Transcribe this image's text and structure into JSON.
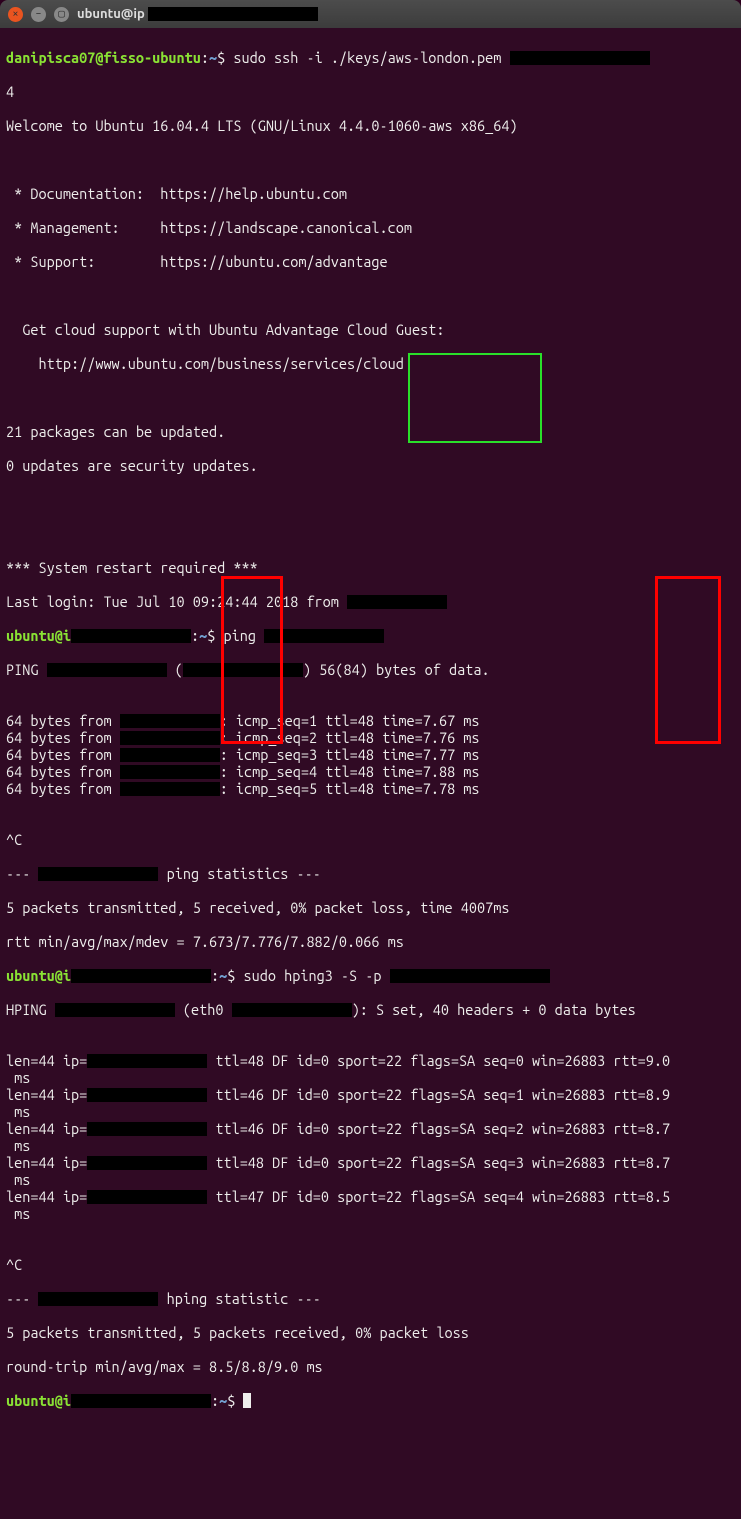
{
  "window": {
    "title_prefix": "ubuntu@ip"
  },
  "prompt1": {
    "user": "danipisca07",
    "host": "fisso-ubuntu",
    "path": "~",
    "cmd": "sudo ssh -i ./keys/aws-london.pem "
  },
  "motd": {
    "l1": "4",
    "l2": "Welcome to Ubuntu 16.04.4 LTS (GNU/Linux 4.4.0-1060-aws x86_64)",
    "doc": " * Documentation:  https://help.ubuntu.com",
    "mgmt": " * Management:     https://landscape.canonical.com",
    "sup": " * Support:        https://ubuntu.com/advantage",
    "cloud1": "  Get cloud support with Ubuntu Advantage Cloud Guest:",
    "cloud2": "    http://www.ubuntu.com/business/services/cloud",
    "pkg1": "21 packages can be updated.",
    "pkg2": "0 updates are security updates.",
    "restart": "*** System restart required ***",
    "last": "Last login: Tue Jul 10 09:24:44 2018 from "
  },
  "prompt2": {
    "user": "ubuntu",
    "host_prefix": "i",
    "path": "~",
    "cmd": "ping "
  },
  "ping_header_a": "PING ",
  "ping_header_b": " (",
  "ping_header_c": ") 56(84) bytes of data.",
  "ping_rows": [
    {
      "prefix": "64 bytes from ",
      "tail": ": icmp_seq=1",
      "ttl": "ttl=48",
      "time": "time=7.67 ms"
    },
    {
      "prefix": "64 bytes from ",
      "tail": ": icmp_seq=2",
      "ttl": "ttl=48",
      "time": "time=7.76 ms"
    },
    {
      "prefix": "64 bytes from ",
      "tail": ": icmp_seq=3",
      "ttl": "ttl=48",
      "time": "time=7.77 ms"
    },
    {
      "prefix": "64 bytes from ",
      "tail": ": icmp_seq=4",
      "ttl": "ttl=48",
      "time": "time=7.88 ms"
    },
    {
      "prefix": "64 bytes from ",
      "tail": ": icmp_seq=5",
      "ttl": "ttl=48",
      "time": "time=7.78 ms"
    }
  ],
  "ctrl_c": "^C",
  "ping_stats_hdr_a": "--- ",
  "ping_stats_hdr_b": " ping statistics ---",
  "ping_stats1": "5 packets transmitted, 5 received, 0% packet loss, time 4007ms",
  "ping_stats2": "rtt min/avg/max/mdev = 7.673/7.776/7.882/0.066 ms",
  "prompt3": {
    "user": "ubuntu",
    "host_prefix": "i",
    "path": "~",
    "cmd": "sudo hping3 -S -p "
  },
  "hping_hdr_a": "HPING ",
  "hping_hdr_b": " (eth0 ",
  "hping_hdr_c": "): S set, 40 headers + 0 data bytes",
  "hping_rows": [
    {
      "a": "len=44 ip=",
      "ttl": "ttl=48",
      "mid": " DF id=0 sport=22 flags=SA seq=0 win=26883 ",
      "rtt": "rtt=9.0",
      "ms": " ms"
    },
    {
      "a": "len=44 ip=",
      "ttl": "ttl=46",
      "mid": " DF id=0 sport=22 flags=SA seq=1 win=26883 ",
      "rtt": "rtt=8.9",
      "ms": " ms"
    },
    {
      "a": "len=44 ip=",
      "ttl": "ttl=46",
      "mid": " DF id=0 sport=22 flags=SA seq=2 win=26883 ",
      "rtt": "rtt=8.7",
      "ms": " ms"
    },
    {
      "a": "len=44 ip=",
      "ttl": "ttl=48",
      "mid": " DF id=0 sport=22 flags=SA seq=3 win=26883 ",
      "rtt": "rtt=8.7",
      "ms": " ms"
    },
    {
      "a": "len=44 ip=",
      "ttl": "ttl=47",
      "mid": " DF id=0 sport=22 flags=SA seq=4 win=26883 ",
      "rtt": "rtt=8.5",
      "ms": " ms"
    }
  ],
  "hping_stats_hdr_a": "--- ",
  "hping_stats_hdr_b": " hping statistic ---",
  "hping_stats1": "5 packets transmitted, 5 packets received, 0% packet loss",
  "hping_stats2": "round-trip min/avg/max = 8.5/8.8/9.0 ms",
  "prompt4": {
    "user": "ubuntu",
    "host_prefix": "i",
    "path": "~",
    "cmd": ""
  }
}
